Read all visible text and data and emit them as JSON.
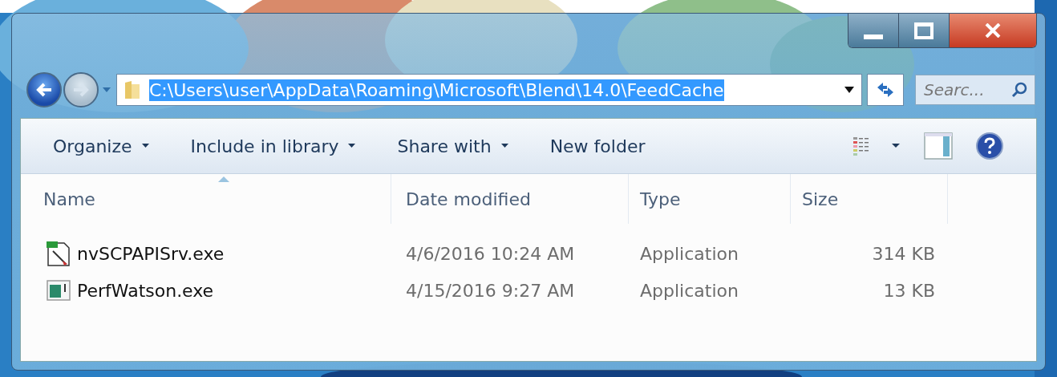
{
  "address_bar": {
    "path": "C:\\Users\\user\\AppData\\Roaming\\Microsoft\\Blend\\14.0\\FeedCache",
    "selected": true
  },
  "search": {
    "placeholder": "Searc..."
  },
  "toolbar": {
    "menus": [
      {
        "label": "Organize",
        "dropdown": true
      },
      {
        "label": "Include in library",
        "dropdown": true
      },
      {
        "label": "Share with",
        "dropdown": true
      },
      {
        "label": "New folder",
        "dropdown": false
      }
    ]
  },
  "table": {
    "columns": [
      "Name",
      "Date modified",
      "Type",
      "Size"
    ],
    "rows": [
      {
        "kind": "paint",
        "name": "nvSCPAPISrv.exe",
        "date": "4/6/2016 10:24 AM",
        "type": "Application",
        "size": "314 KB"
      },
      {
        "kind": "app",
        "name": "PerfWatson.exe",
        "date": "4/15/2016 9:27 AM",
        "type": "Application",
        "size": "13 KB"
      }
    ]
  }
}
